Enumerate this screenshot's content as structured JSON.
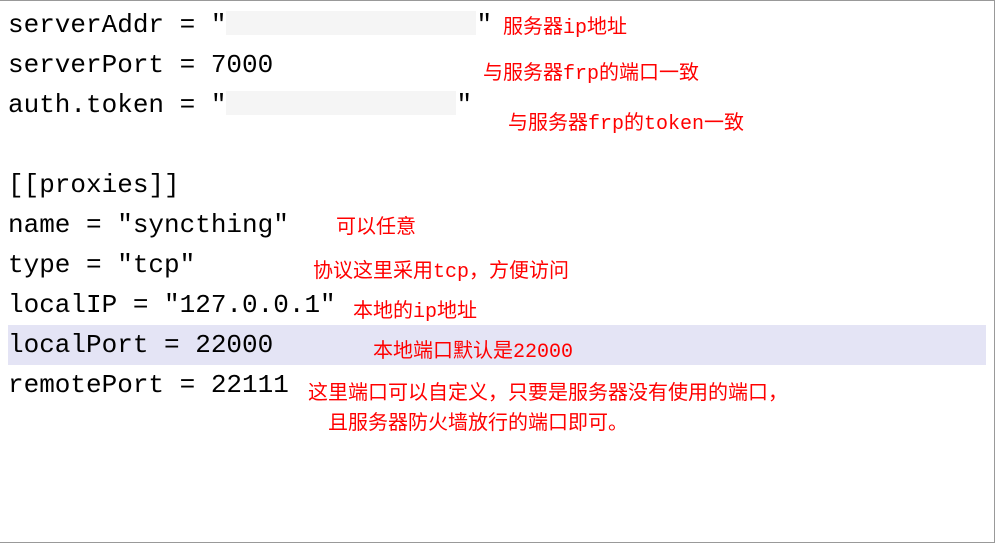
{
  "code": {
    "line1_prefix": "serverAddr = \"",
    "line1_suffix": "\"",
    "line2": "serverPort = 7000",
    "line3_prefix": "auth.token = \"",
    "line3_suffix": "\"",
    "line5": "[[proxies]]",
    "line6": "name = \"syncthing\"",
    "line7": "type = \"tcp\"",
    "line8": "localIP = \"127.0.0.1\"",
    "line9": "localPort = 22000",
    "line10": "remotePort = 22111"
  },
  "annotations": {
    "a1": "服务器ip地址",
    "a2": "与服务器frp的端口一致",
    "a3": "与服务器frp的token一致",
    "a6": "可以任意",
    "a7": "协议这里采用tcp，方便访问",
    "a8": "本地的ip地址",
    "a9": "本地端口默认是22000",
    "a10_line1": "这里端口可以自定义，只要是服务器没有使用的端口，",
    "a10_line2": "且服务器防火墙放行的端口即可。"
  }
}
